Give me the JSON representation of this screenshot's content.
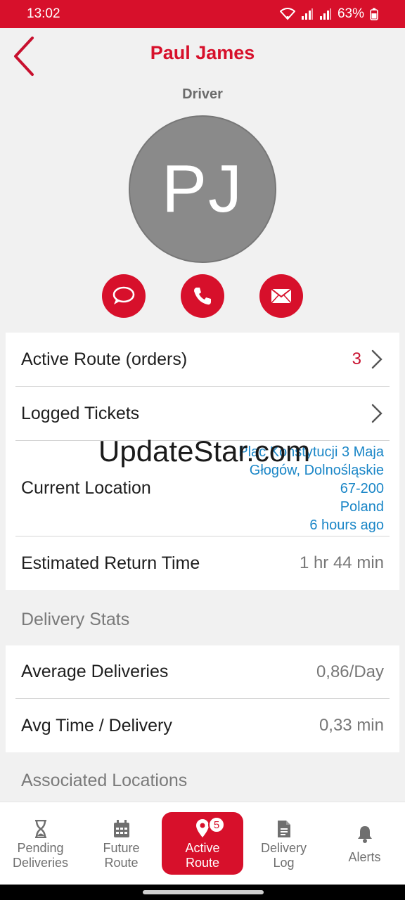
{
  "status_bar": {
    "time": "13:02",
    "battery": "63%"
  },
  "header": {
    "title": "Paul James",
    "role": "Driver"
  },
  "avatar": {
    "initials": "PJ"
  },
  "rows": {
    "active_route": {
      "label": "Active Route (orders)",
      "count": "3"
    },
    "logged_tickets": {
      "label": "Logged Tickets"
    },
    "current_location": {
      "label": "Current Location",
      "lines": [
        "Plac Konstytucji 3 Maja",
        "Głogów, Dolnośląskie",
        "67-200",
        "Poland",
        "6 hours ago"
      ]
    },
    "estimated_return": {
      "label": "Estimated Return Time",
      "value": "1 hr 44 min"
    }
  },
  "delivery_stats": {
    "title": "Delivery Stats",
    "average_deliveries": {
      "label": "Average Deliveries",
      "value": "0,86/Day"
    },
    "avg_time": {
      "label": "Avg Time / Delivery",
      "value": "0,33 min"
    }
  },
  "associated_locations": {
    "title": "Associated Locations"
  },
  "watermark": "UpdateStar.com",
  "tabs": [
    {
      "line1": "Pending",
      "line2": "Deliveries"
    },
    {
      "line1": "Future",
      "line2": "Route"
    },
    {
      "line1": "Active",
      "line2": "Route",
      "badge": "5"
    },
    {
      "line1": "Delivery",
      "line2": "Log"
    },
    {
      "line1": "Alerts",
      "line2": ""
    }
  ],
  "colors": {
    "accent": "#d7102b",
    "link": "#1a86c7",
    "avatar_bg": "#8a8a8a"
  }
}
